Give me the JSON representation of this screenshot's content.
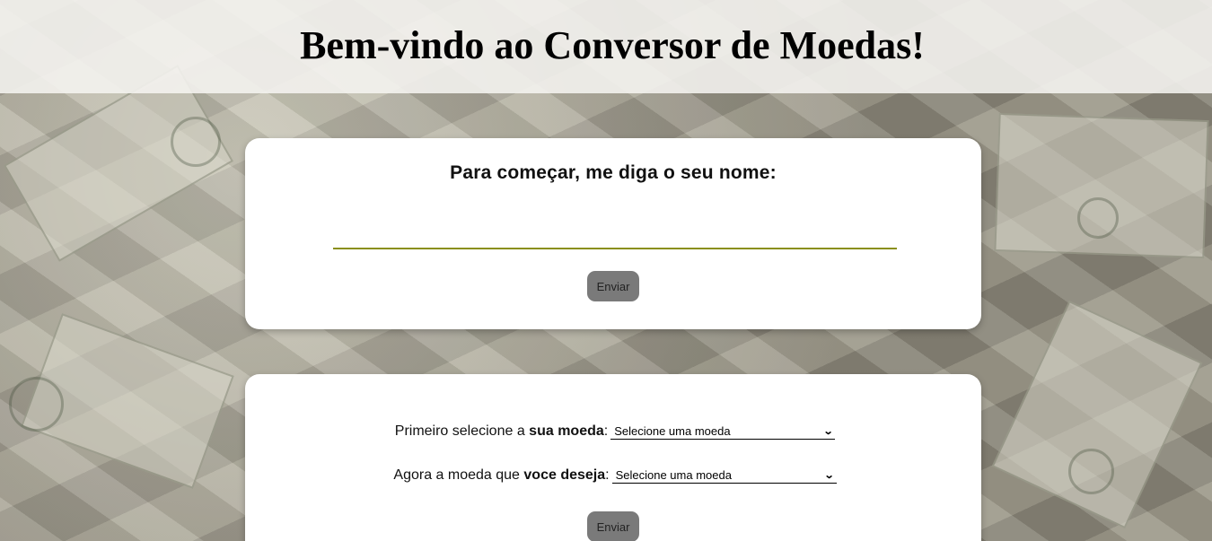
{
  "header": {
    "title": "Bem-vindo ao Conversor de Moedas!"
  },
  "name_card": {
    "question": "Para começar, me diga o seu nome:",
    "input_value": "",
    "input_placeholder": "",
    "submit_label": "Enviar"
  },
  "currency_card": {
    "first_label_prefix": "Primeiro selecione a ",
    "first_label_bold": "sua moeda",
    "first_label_suffix": ":",
    "first_select_value": "Selecione uma moeda",
    "second_label_prefix": "Agora a moeda que ",
    "second_label_bold": "voce deseja",
    "second_label_suffix": ":",
    "second_select_value": "Selecione uma moeda",
    "submit_label": "Enviar"
  },
  "icons": {
    "dropdown": "chevron-down-icon"
  },
  "colors": {
    "input_underline": "#8a8f16",
    "button_bg": "#7a7a7a",
    "card_bg": "#ffffff",
    "header_bg": "#f5f4f0"
  }
}
